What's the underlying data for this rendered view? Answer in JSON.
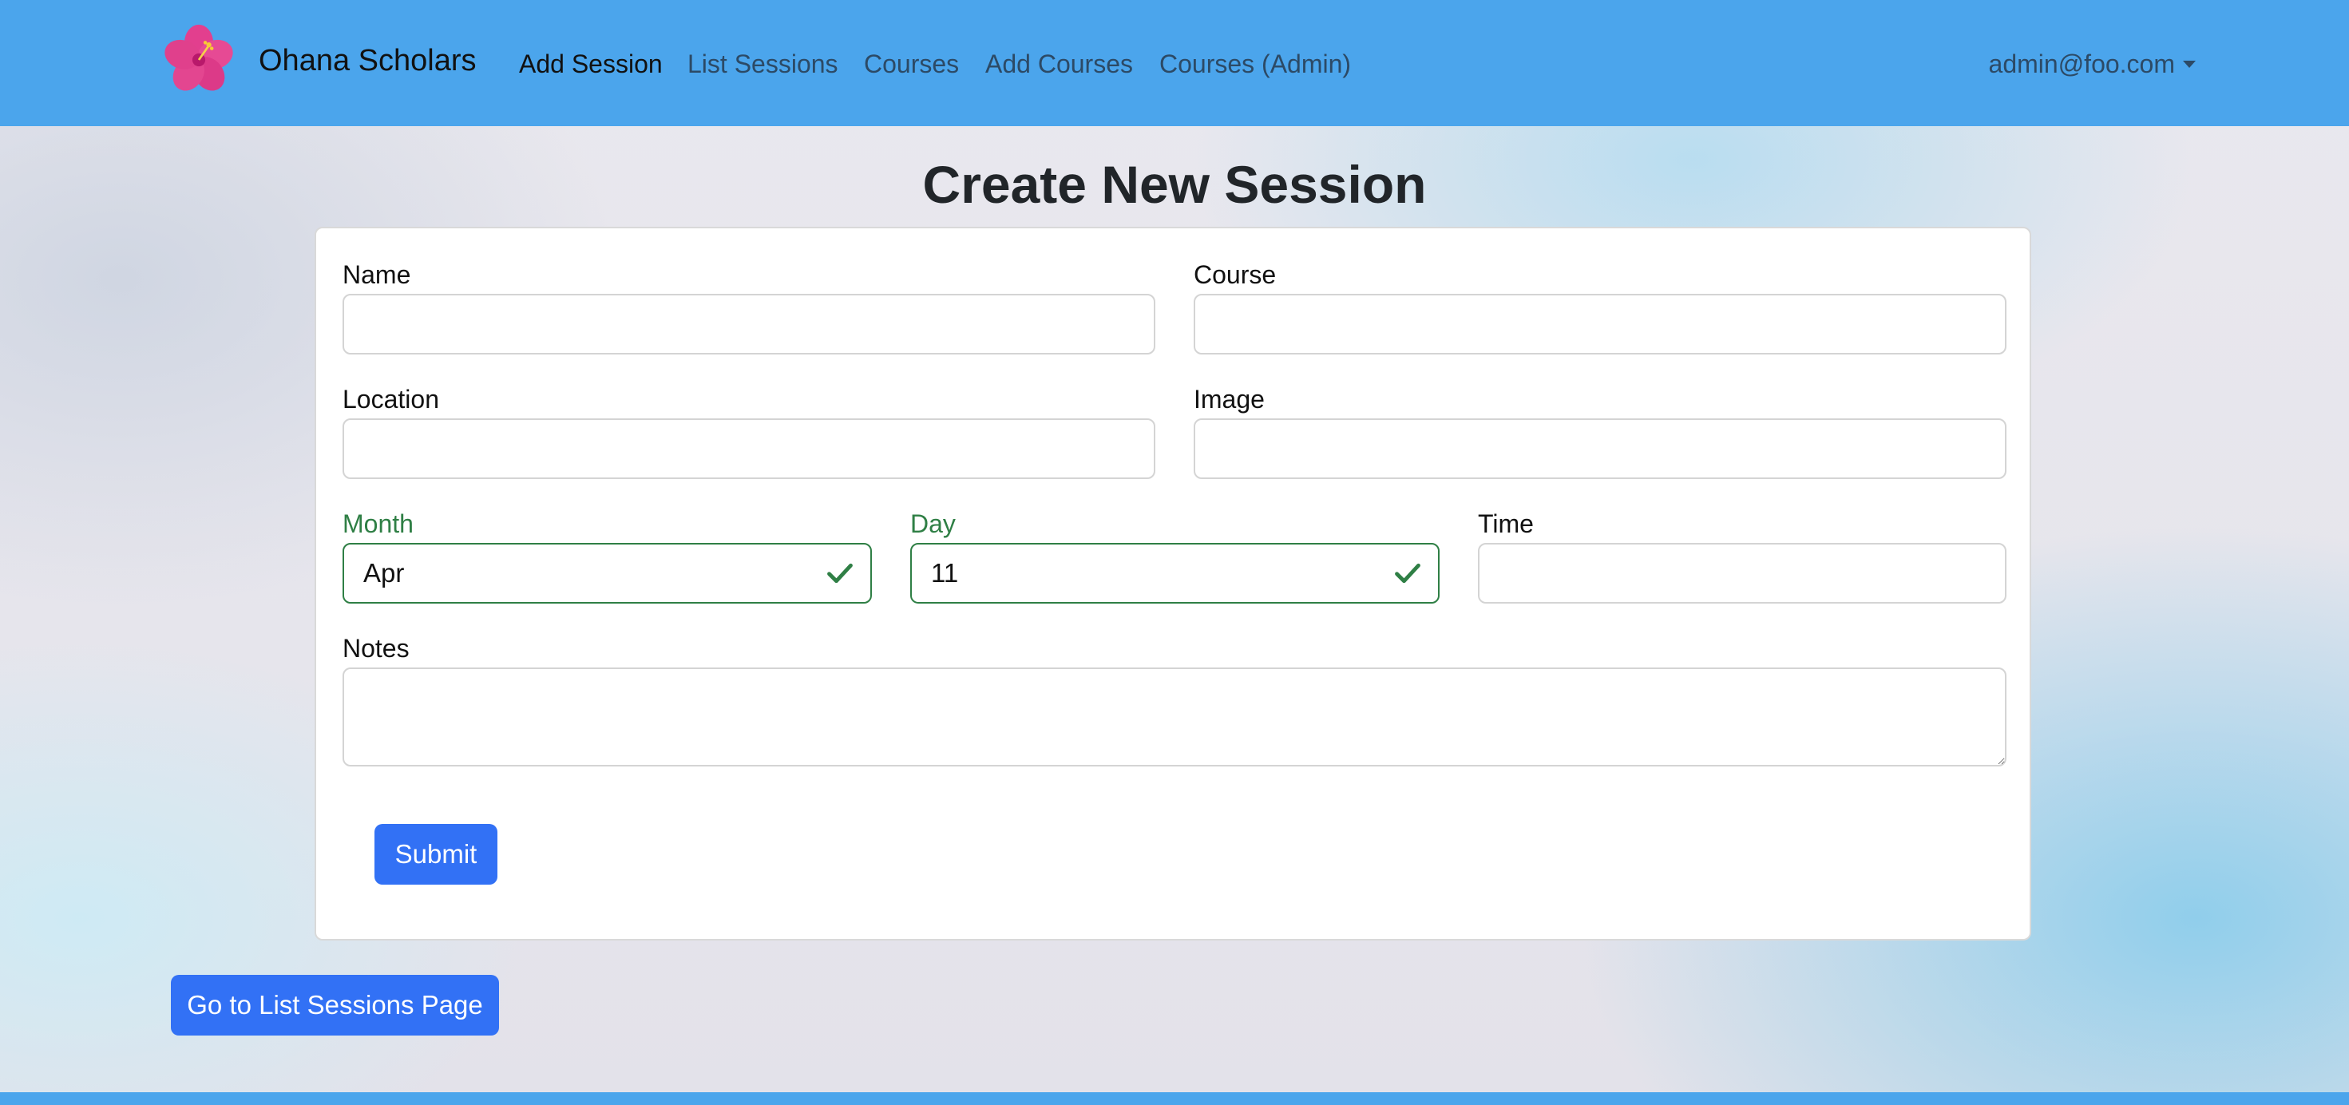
{
  "navbar": {
    "brand": "Ohana Scholars",
    "links": [
      {
        "label": "Add Session",
        "active": true
      },
      {
        "label": "List Sessions",
        "active": false
      },
      {
        "label": "Courses",
        "active": false
      },
      {
        "label": "Add Courses",
        "active": false
      },
      {
        "label": "Courses (Admin)",
        "active": false
      }
    ],
    "user": "admin@foo.com",
    "logo_icon": "hibiscus-logo-icon"
  },
  "page": {
    "title": "Create New Session"
  },
  "form": {
    "name": {
      "label": "Name",
      "value": ""
    },
    "course": {
      "label": "Course",
      "value": ""
    },
    "location": {
      "label": "Location",
      "value": ""
    },
    "image": {
      "label": "Image",
      "value": ""
    },
    "month": {
      "label": "Month",
      "value": "Apr",
      "valid": true
    },
    "day": {
      "label": "Day",
      "value": "11",
      "valid": true
    },
    "time": {
      "label": "Time",
      "value": ""
    },
    "notes": {
      "label": "Notes",
      "value": ""
    },
    "submit_label": "Submit"
  },
  "actions": {
    "list_sessions_label": "Go to List Sessions Page"
  },
  "colors": {
    "navbar": "#4ba5ec",
    "primary_button": "#3271f5",
    "valid": "#2f7f45"
  }
}
